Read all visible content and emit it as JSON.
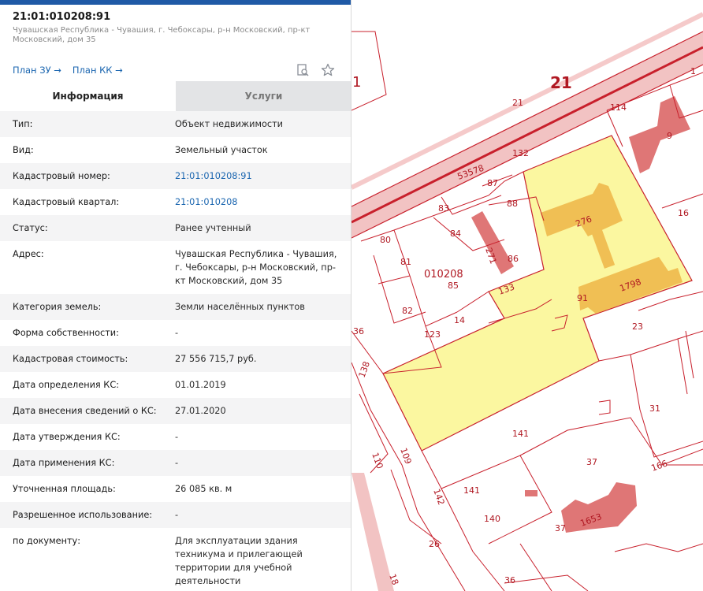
{
  "header": {
    "cad_number": "21:01:010208:91",
    "address": "Чувашская Республика - Чувашия, г. Чебоксары, р-н Московский, пр-кт Московский, дом 35",
    "links": {
      "plan_zu": "План ЗУ →",
      "plan_kk": "План КК →"
    },
    "icons": [
      "search-document-icon",
      "star-icon"
    ]
  },
  "tabs": {
    "info": "Информация",
    "services": "Услуги"
  },
  "rows": {
    "type_l": "Тип:",
    "type_v": "Объект недвижимости",
    "kind_l": "Вид:",
    "kind_v": "Земельный участок",
    "cadnum_l": "Кадастровый номер:",
    "cadnum_v": "21:01:010208:91",
    "quarter_l": "Кадастровый квартал:",
    "quarter_v": "21:01:010208",
    "status_l": "Статус:",
    "status_v": "Ранее учтенный",
    "addr_l": "Адрес:",
    "addr_v": "Чувашская Республика - Чувашия, г. Чебоксары, р-н Московский, пр-кт Московский, дом 35",
    "cat_l": "Категория земель:",
    "cat_v": "Земли населённых пунктов",
    "own_l": "Форма собственности:",
    "own_v": "-",
    "cost_l": "Кадастровая стоимость:",
    "cost_v": "27 556 715,7 руб.",
    "d_def_l": "Дата определения КС:",
    "d_def_v": "01.01.2019",
    "d_ins_l": "Дата внесения сведений о КС:",
    "d_ins_v": "27.01.2020",
    "d_app_l": "Дата утверждения КС:",
    "d_app_v": "-",
    "d_use_l": "Дата применения КС:",
    "d_use_v": "-",
    "area_l": "Уточненная площадь:",
    "area_v": "26 085 кв. м",
    "use_l": "Разрешенное использование:",
    "use_v": "-",
    "doc_l": "по документу:",
    "doc_v": "Для эксплуатации здания техникума и прилегающей территории для учебной деятельности"
  },
  "map": {
    "labels": {
      "q21": "21",
      "l21": "21",
      "l1": "1",
      "l114": "114",
      "l9": "9",
      "l132": "132",
      "l53578": "53578",
      "l87": "87",
      "l88": "88",
      "l83": "83",
      "l84": "84",
      "l271": "271",
      "l86": "86",
      "l80": "80",
      "l81": "81",
      "l010208": "010208",
      "l85": "85",
      "l276": "276",
      "l16": "16",
      "l91": "91",
      "l1798": "1798",
      "l133": "133",
      "l82": "82",
      "l14": "14",
      "l123": "123",
      "l36": "36",
      "l23": "23",
      "l138": "138",
      "l31": "31",
      "l141": "141",
      "l109": "109",
      "l110": "110",
      "l37": "37",
      "l166": "166",
      "l142": "142",
      "l141b": "141",
      "l140": "140",
      "l37b": "37",
      "l1653": "1653",
      "l26": "26",
      "l36b": "36",
      "l18": "18",
      "l1b": "1"
    },
    "colors": {
      "boundary": "#c8202c",
      "road": "#f2c3c3",
      "parcel": "#fbf7a0",
      "building": "#f0bf54",
      "other_building": "#df7676"
    }
  }
}
